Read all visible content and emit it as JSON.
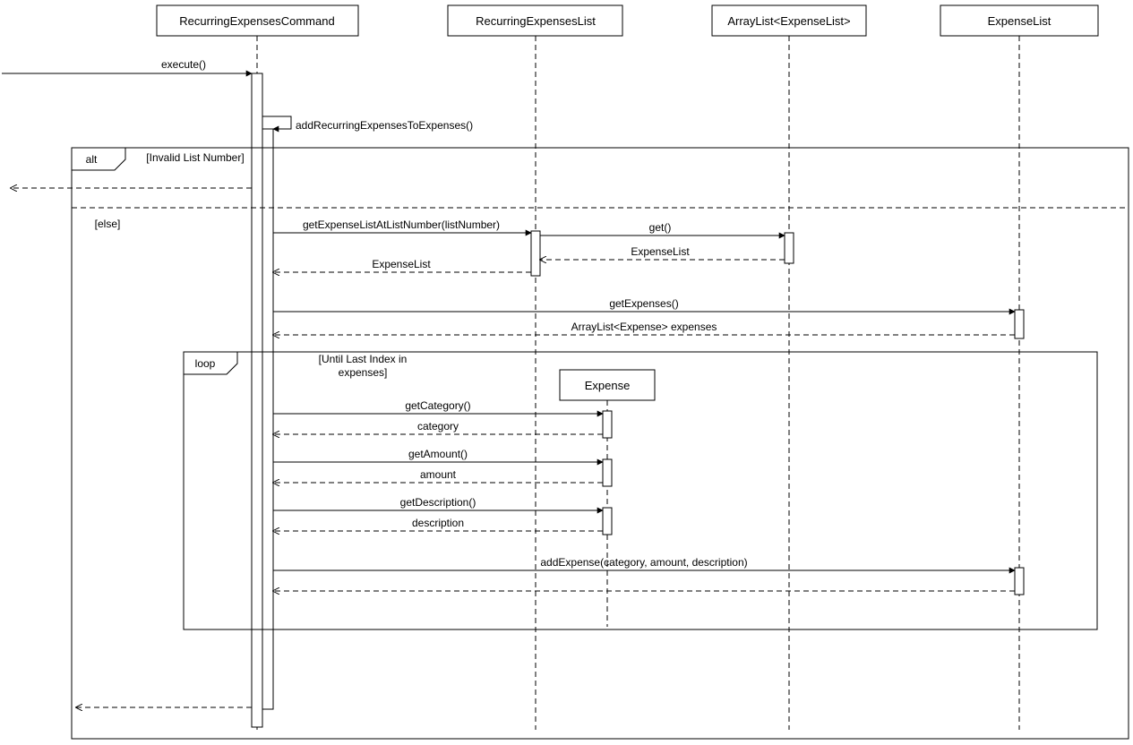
{
  "participants": {
    "p1": "RecurringExpensesCommand",
    "p2": "RecurringExpensesList",
    "p3": "ArrayList<ExpenseList>",
    "p4": "ExpenseList",
    "p5": "Expense"
  },
  "messages": {
    "m1": "execute()",
    "m2": "addRecurringExpensesToExpenses()",
    "m3": "getExpenseListAtListNumber(listNumber)",
    "m4": "get()",
    "m5": "ExpenseList",
    "m6": "ExpenseList",
    "m7": "getExpenses()",
    "m8": "ArrayList<Expense> expenses",
    "m9": "getCategory()",
    "m10": "category",
    "m11": "getAmount()",
    "m12": "amount",
    "m13": "getDescription()",
    "m14": "description",
    "m15": "addExpense(category, amount, description)"
  },
  "fragments": {
    "alt": "alt",
    "guard1": "[Invalid List Number]",
    "guard2": "[else]",
    "loop": "loop",
    "loopGuard": "[Until Last Index in expenses]"
  }
}
